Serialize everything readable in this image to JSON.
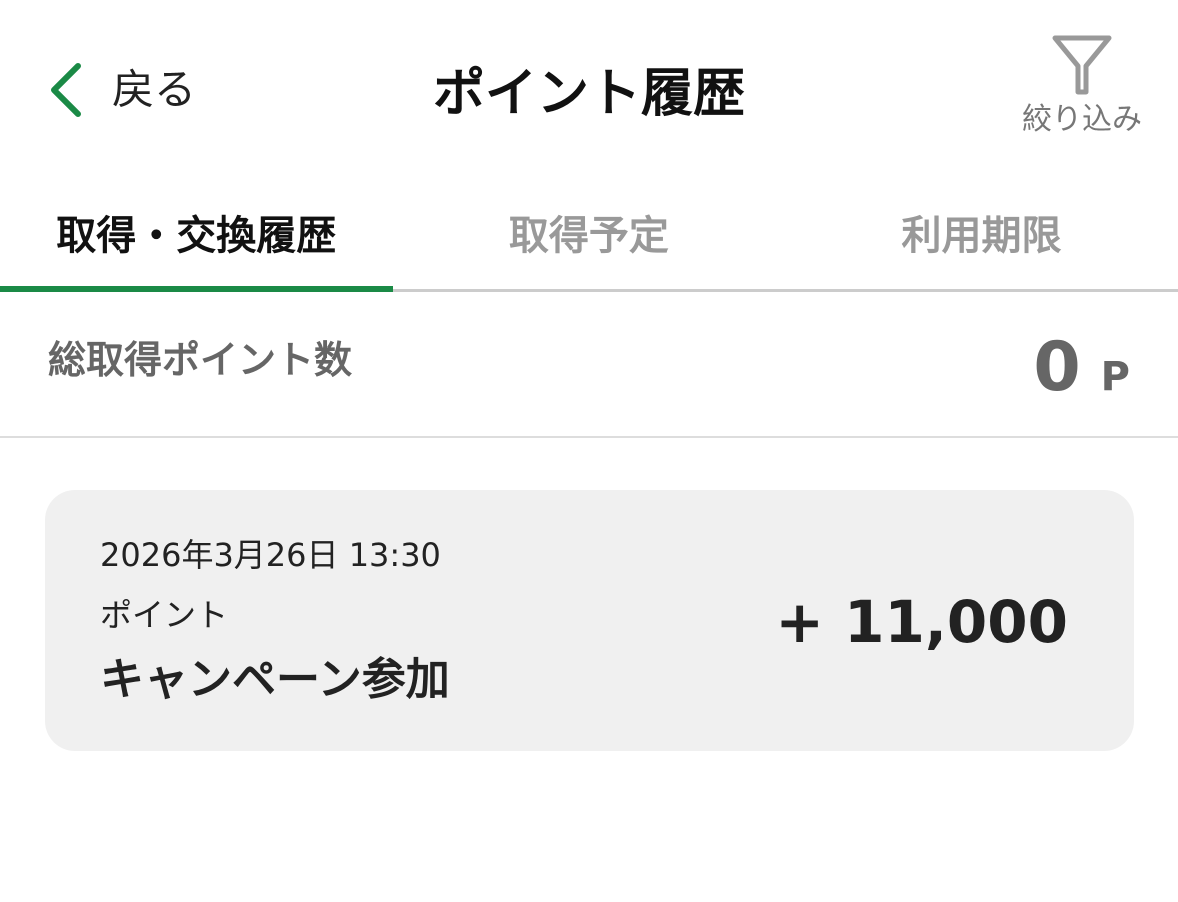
{
  "header": {
    "back_label": "戻る",
    "title": "ポイント履歴",
    "filter_label": "絞り込み",
    "accent_color": "#1a8a46"
  },
  "tabs": [
    {
      "label": "取得・交換履歴",
      "active": true
    },
    {
      "label": "取得予定",
      "active": false
    },
    {
      "label": "利用期限",
      "active": false
    }
  ],
  "summary": {
    "label": "総取得ポイント数",
    "value": "0",
    "unit": "P"
  },
  "history": [
    {
      "date": "2026年3月26日 13:30",
      "type": "ポイント",
      "title": "キャンペーン参加",
      "amount": "+ 11,000"
    }
  ],
  "icons": {
    "back": "chevron-left-icon",
    "filter": "funnel-icon"
  }
}
